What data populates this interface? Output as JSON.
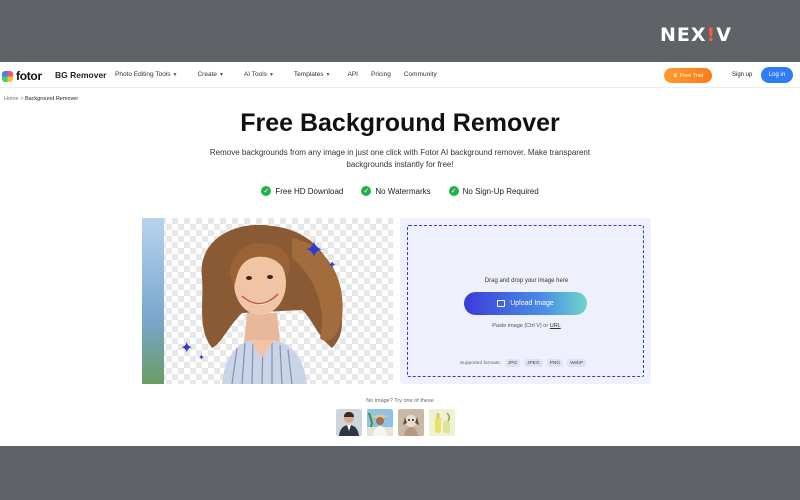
{
  "watermark": {
    "left": "NEX",
    "bang": "!",
    "right": "V"
  },
  "nav": {
    "logo": "fotor",
    "product": "BG Remover",
    "menu": [
      {
        "label": "Photo Editing Tools",
        "dropdown": true
      },
      {
        "label": "Create",
        "dropdown": true
      },
      {
        "label": "AI Tools",
        "dropdown": true
      },
      {
        "label": "Templates",
        "dropdown": true
      },
      {
        "label": "API",
        "dropdown": false
      },
      {
        "label": "Pricing",
        "dropdown": false
      },
      {
        "label": "Community",
        "dropdown": false
      }
    ],
    "free_trial": "Free Trial",
    "signup": "Sign up",
    "login": "Log in"
  },
  "breadcrumb": {
    "home": "Home",
    "separator": ">",
    "current": "Background Remover"
  },
  "hero": {
    "title": "Free Background Remover",
    "subtitle": "Remove backgrounds from any image in just one click with Fotor AI background remover. Make transparent backgrounds instantly for free!",
    "features": [
      "Free HD Download",
      "No Watermarks",
      "No Sign-Up Required"
    ]
  },
  "upload": {
    "drag_text": "Drag and drop your image here",
    "button": "Upload Image",
    "paste_prefix": "Paste image (Ctrl V) or",
    "paste_link": "URL",
    "formats_label": "Supported formats:",
    "formats": [
      "JPG",
      "JPEG",
      "PNG",
      "WebP"
    ]
  },
  "samples": {
    "prompt": "No image? Try one of these",
    "items": [
      "sample-man-suit",
      "sample-woman-hat",
      "sample-dog",
      "sample-product-bottles"
    ]
  },
  "colors": {
    "accent": "#2f3bd6",
    "login": "#2e7cf6",
    "trial": "#ff8a24",
    "check": "#22b04b"
  }
}
